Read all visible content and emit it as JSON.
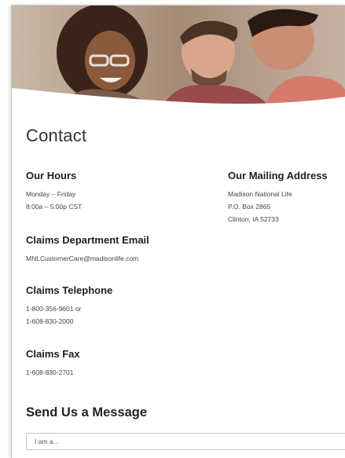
{
  "contact": {
    "title": "Contact",
    "hours": {
      "heading": "Our Hours",
      "days": "Monday – Friday",
      "time": "8:00a – 5:00p CST"
    },
    "mailing": {
      "heading": "Our Mailing Address",
      "line1": "Madison National Life",
      "line2": "P.O. Box 2865",
      "line3": "Clinton, IA 52733"
    },
    "claims_email": {
      "heading": "Claims Department Email",
      "value": "MNLCustomerCare@madisonlife.com"
    },
    "claims_phone": {
      "heading": "Claims Telephone",
      "line1": "1-800-356-9601 or",
      "line2": "1-608-830-2000"
    },
    "claims_fax": {
      "heading": "Claims Fax",
      "value": "1-608-830-2701"
    }
  },
  "message": {
    "heading": "Send Us a Message",
    "select_placeholder": "I am a..."
  }
}
